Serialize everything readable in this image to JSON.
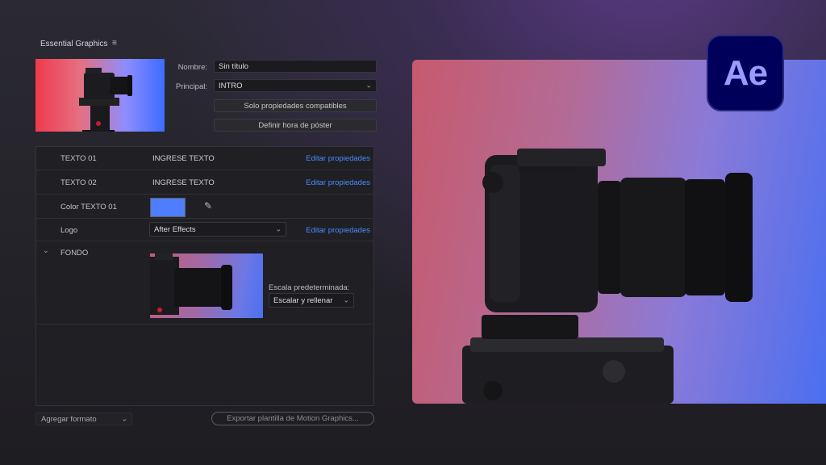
{
  "panel": {
    "title": "Essential Graphics",
    "menu_icon": "≡"
  },
  "fields": {
    "name_label": "Nombre:",
    "name_value": "Sin título",
    "principal_label": "Principal:",
    "principal_value": "INTRO",
    "compat_button": "Solo propiedades compatibles",
    "poster_button": "Definir hora de póster"
  },
  "properties": {
    "rows": [
      {
        "name": "TEXTO 01",
        "value": "INGRESE TEXTO",
        "link": "Editar propiedades"
      },
      {
        "name": "TEXTO 02",
        "value": "INGRESE TEXTO",
        "link": "Editar propiedades"
      },
      {
        "name": "Color TEXTO 01",
        "swatch": "#4f7dff"
      },
      {
        "name": "Logo",
        "value": "After Effects",
        "link": "Editar propiedades"
      },
      {
        "name": "FONDO",
        "scale_label": "Escala predeterminada:",
        "scale_value": "Escalar y rellenar"
      }
    ]
  },
  "bottom": {
    "format_select": "Agregar formato",
    "export_button": "Exportar plantilla de Motion Graphics..."
  },
  "logo": {
    "text": "Ae",
    "bg": "#00005b",
    "fg": "#9a9aff"
  }
}
